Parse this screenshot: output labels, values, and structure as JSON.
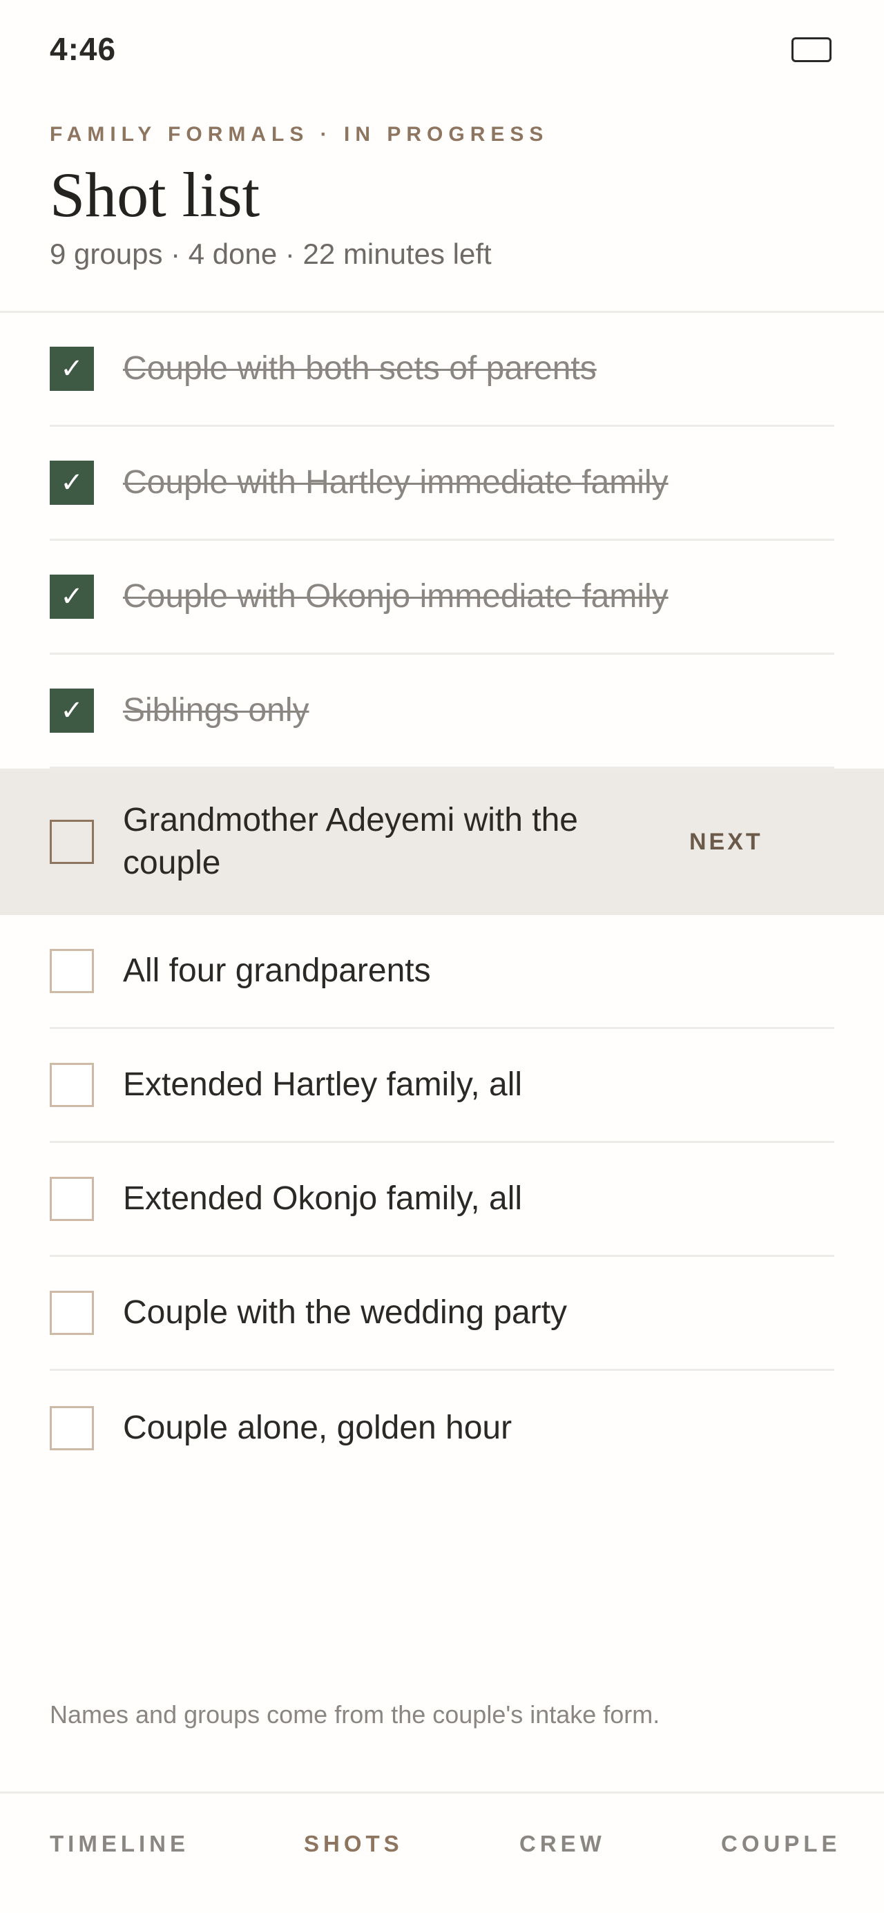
{
  "status": {
    "time": "4:46"
  },
  "header": {
    "eyebrow": "FAMILY FORMALS · IN PROGRESS",
    "title": "Shot list",
    "subtitle": "9 groups · 4 done · 22 minutes left"
  },
  "shots": [
    {
      "label": "Couple with both sets of parents",
      "done": true
    },
    {
      "label": "Couple with Hartley immediate family",
      "done": true
    },
    {
      "label": "Couple with Okonjo immediate family",
      "done": true
    },
    {
      "label": "Siblings only",
      "done": true
    },
    {
      "label": "Grandmother Adeyemi with the couple",
      "done": false,
      "next": true,
      "badge": "NEXT"
    },
    {
      "label": "All four grandparents",
      "done": false
    },
    {
      "label": "Extended Hartley family, all",
      "done": false
    },
    {
      "label": "Extended Okonjo family, all",
      "done": false
    },
    {
      "label": "Couple with the wedding party",
      "done": false
    },
    {
      "label": "Couple alone, golden hour",
      "done": false
    }
  ],
  "footnote": "Names and groups come from the couple's intake form.",
  "nav": {
    "timeline": "TIMELINE",
    "shots": "SHOTS",
    "crew": "CREW",
    "couple": "COUPLE",
    "active": "shots"
  },
  "icons": {
    "check": "checkmark-icon",
    "battery": "battery-icon"
  },
  "colors": {
    "accent": "#8e7560",
    "check": "#3e5a45",
    "next_bg": "#edeae6"
  }
}
